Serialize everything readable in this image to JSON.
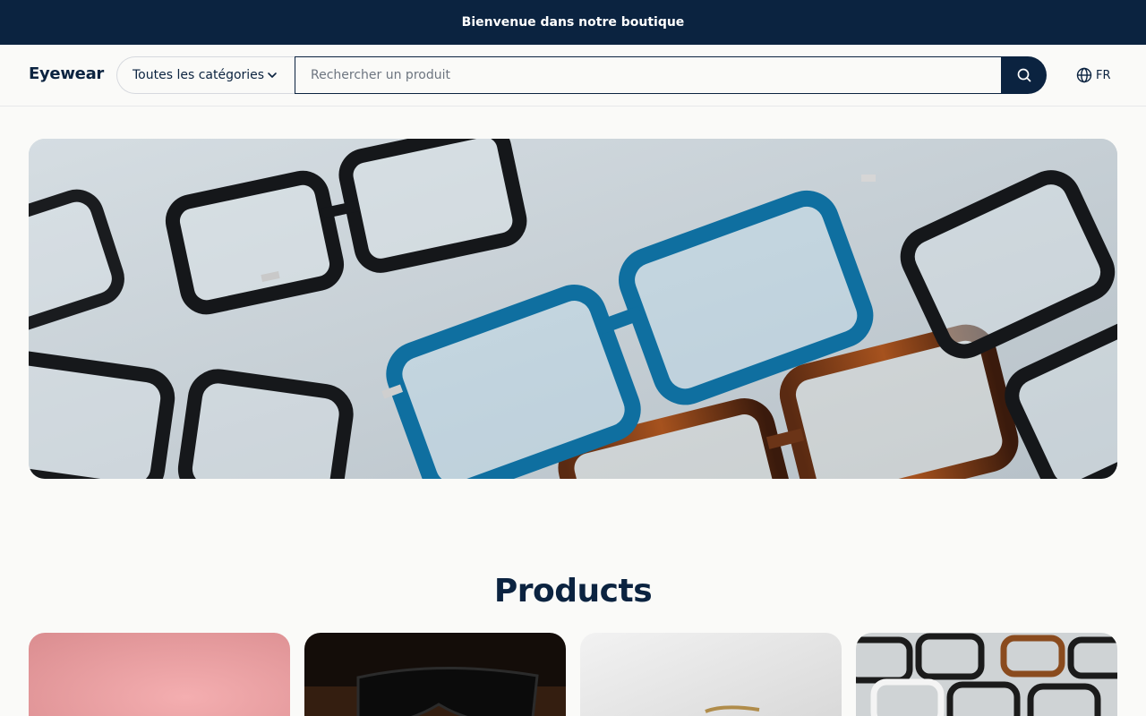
{
  "announcement": "Bienvenue dans notre boutique",
  "header": {
    "logo": "Eyewear",
    "category_select": "Toutes les catégories",
    "search_placeholder": "Rechercher un produit",
    "language": "FR"
  },
  "products": {
    "title": "Products"
  },
  "colors": {
    "brand_navy": "#0b2340",
    "background": "#fafaf8"
  }
}
